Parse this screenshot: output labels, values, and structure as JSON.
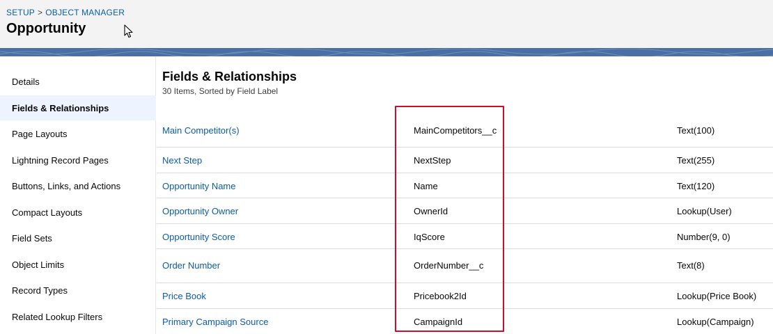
{
  "header": {
    "breadcrumb": [
      "SETUP",
      "OBJECT MANAGER"
    ],
    "breadcrumb_separator": ">",
    "title": "Opportunity"
  },
  "sidebar": {
    "items": [
      {
        "label": "Details"
      },
      {
        "label": "Fields & Relationships",
        "active": true
      },
      {
        "label": "Page Layouts"
      },
      {
        "label": "Lightning Record Pages"
      },
      {
        "label": "Buttons, Links, and Actions"
      },
      {
        "label": "Compact Layouts"
      },
      {
        "label": "Field Sets"
      },
      {
        "label": "Object Limits"
      },
      {
        "label": "Record Types"
      },
      {
        "label": "Related Lookup Filters"
      }
    ]
  },
  "main": {
    "title": "Fields & Relationships",
    "subtitle": "30 Items, Sorted by Field Label",
    "rows": [
      {
        "label": "Main Competitor(s)",
        "api_name": "MainCompetitors__c",
        "type": "Text(100)"
      },
      {
        "label": "Next Step",
        "api_name": "NextStep",
        "type": "Text(255)"
      },
      {
        "label": "Opportunity Name",
        "api_name": "Name",
        "type": "Text(120)"
      },
      {
        "label": "Opportunity Owner",
        "api_name": "OwnerId",
        "type": "Lookup(User)"
      },
      {
        "label": "Opportunity Score",
        "api_name": "IqScore",
        "type": "Number(9, 0)"
      },
      {
        "label": "Order Number",
        "api_name": "OrderNumber__c",
        "type": "Text(8)"
      },
      {
        "label": "Price Book",
        "api_name": "Pricebook2Id",
        "type": "Lookup(Price Book)"
      },
      {
        "label": "Primary Campaign Source",
        "api_name": "CampaignId",
        "type": "Lookup(Campaign)"
      }
    ]
  },
  "colors": {
    "link": "#0b5cab",
    "highlight_box": "#c8102e",
    "banner": "#4a6fa5",
    "active_item_bg": "#eef4ff"
  }
}
